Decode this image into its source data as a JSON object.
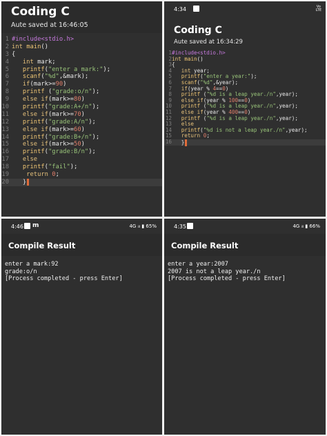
{
  "editor1": {
    "app_title": "Coding C",
    "autosave": "Aute saved at 16:46:05",
    "lines": [
      {
        "n": "1",
        "tokens": [
          [
            "pp",
            "#include<stdio.h>"
          ]
        ]
      },
      {
        "n": "2",
        "tokens": [
          [
            "kw",
            "int "
          ],
          [
            "fn",
            "main"
          ],
          [
            "",
            "()"
          ]
        ]
      },
      {
        "n": "3",
        "tokens": [
          [
            "",
            "{"
          ]
        ]
      },
      {
        "n": "4",
        "tokens": [
          [
            "",
            "   "
          ],
          [
            "kw",
            "int "
          ],
          [
            "",
            "mark;"
          ]
        ]
      },
      {
        "n": "5",
        "tokens": [
          [
            "",
            "   "
          ],
          [
            "fn",
            "printf"
          ],
          [
            "",
            "("
          ],
          [
            "st",
            "\"enter a mark:\""
          ],
          [
            "",
            ");"
          ]
        ]
      },
      {
        "n": "6",
        "tokens": [
          [
            "",
            "   "
          ],
          [
            "fn",
            "scanf"
          ],
          [
            "",
            "("
          ],
          [
            "st",
            "\"%d\""
          ],
          [
            "",
            ",&mark);"
          ]
        ]
      },
      {
        "n": "7",
        "tokens": [
          [
            "",
            "   "
          ],
          [
            "kw",
            "if"
          ],
          [
            "",
            "(mark>="
          ],
          [
            "nm",
            "90"
          ],
          [
            "",
            ")"
          ]
        ]
      },
      {
        "n": "8",
        "tokens": [
          [
            "",
            "   "
          ],
          [
            "fn",
            "printf"
          ],
          [
            "",
            " ("
          ],
          [
            "st",
            "\"grade:o/n\""
          ],
          [
            "",
            ");"
          ]
        ]
      },
      {
        "n": "9",
        "tokens": [
          [
            "",
            "   "
          ],
          [
            "kw",
            "else if"
          ],
          [
            "",
            "(mark>="
          ],
          [
            "nm",
            "80"
          ],
          [
            "",
            ")"
          ]
        ]
      },
      {
        "n": "10",
        "tokens": [
          [
            "",
            "   "
          ],
          [
            "fn",
            "printf"
          ],
          [
            "",
            "("
          ],
          [
            "st",
            "\"grade:A+/n\""
          ],
          [
            "",
            ");"
          ]
        ]
      },
      {
        "n": "11",
        "tokens": [
          [
            "",
            "   "
          ],
          [
            "kw",
            "else if"
          ],
          [
            "",
            "(mark>="
          ],
          [
            "nm",
            "70"
          ],
          [
            "",
            ")"
          ]
        ]
      },
      {
        "n": "12",
        "tokens": [
          [
            "",
            "   "
          ],
          [
            "fn",
            "printf"
          ],
          [
            "",
            "("
          ],
          [
            "st",
            "\"grade:A/n\""
          ],
          [
            "",
            ");"
          ]
        ]
      },
      {
        "n": "13",
        "tokens": [
          [
            "",
            "   "
          ],
          [
            "kw",
            "else if"
          ],
          [
            "",
            "(mark>="
          ],
          [
            "nm",
            "60"
          ],
          [
            "",
            ")"
          ]
        ]
      },
      {
        "n": "14",
        "tokens": [
          [
            "",
            "   "
          ],
          [
            "fn",
            "printf"
          ],
          [
            "",
            "("
          ],
          [
            "st",
            "\"grade:B+/n\""
          ],
          [
            "",
            ");"
          ]
        ]
      },
      {
        "n": "15",
        "tokens": [
          [
            "",
            "   "
          ],
          [
            "kw",
            "else if"
          ],
          [
            "",
            "(mark>="
          ],
          [
            "nm",
            "50"
          ],
          [
            "",
            ")"
          ]
        ]
      },
      {
        "n": "16",
        "tokens": [
          [
            "",
            "   "
          ],
          [
            "fn",
            "printf"
          ],
          [
            "",
            "("
          ],
          [
            "st",
            "\"grade:B/n\""
          ],
          [
            "",
            ");"
          ]
        ]
      },
      {
        "n": "17",
        "tokens": [
          [
            "",
            "   "
          ],
          [
            "kw",
            "else"
          ]
        ]
      },
      {
        "n": "18",
        "tokens": [
          [
            "",
            "   "
          ],
          [
            "fn",
            "printf"
          ],
          [
            "",
            "("
          ],
          [
            "st",
            "\"fail\""
          ],
          [
            "",
            ");"
          ]
        ]
      },
      {
        "n": "19",
        "tokens": [
          [
            "",
            "    "
          ],
          [
            "kw",
            "return "
          ],
          [
            "nm",
            "0"
          ],
          [
            "",
            ";"
          ]
        ]
      },
      {
        "n": "20",
        "tokens": [
          [
            "",
            "   }"
          ]
        ],
        "current": true
      }
    ]
  },
  "editor2": {
    "status_time": "4:34",
    "status_lte": "Vo\nLTE",
    "app_title": "Coding C",
    "autosave": "Aute saved at 16:34:29",
    "lines": [
      {
        "n": "1",
        "tokens": [
          [
            "pp",
            "#include<stdio.h>"
          ]
        ]
      },
      {
        "n": "2",
        "tokens": [
          [
            "kw",
            "int "
          ],
          [
            "fn",
            "main"
          ],
          [
            "",
            "()"
          ]
        ]
      },
      {
        "n": "3",
        "tokens": [
          [
            "",
            "{"
          ]
        ]
      },
      {
        "n": "4",
        "tokens": [
          [
            "",
            "   "
          ],
          [
            "kw",
            "int "
          ],
          [
            "",
            "year;"
          ]
        ]
      },
      {
        "n": "5",
        "tokens": [
          [
            "",
            "   "
          ],
          [
            "fn",
            "printf"
          ],
          [
            "",
            "("
          ],
          [
            "st",
            "\"enter a year:\""
          ],
          [
            "",
            ");"
          ]
        ]
      },
      {
        "n": "6",
        "tokens": [
          [
            "",
            "   "
          ],
          [
            "fn",
            "scanf"
          ],
          [
            "",
            "("
          ],
          [
            "st",
            "\"%d\""
          ],
          [
            "",
            ",&year);"
          ]
        ]
      },
      {
        "n": "7",
        "tokens": [
          [
            "",
            "   "
          ],
          [
            "kw",
            "if"
          ],
          [
            "",
            "(year % "
          ],
          [
            "nm",
            "4"
          ],
          [
            "",
            "=="
          ],
          [
            "nm",
            "0"
          ],
          [
            "",
            ")"
          ]
        ]
      },
      {
        "n": "8",
        "tokens": [
          [
            "",
            "   "
          ],
          [
            "fn",
            "printf"
          ],
          [
            "",
            " ("
          ],
          [
            "st",
            "\"%d is a leap year./n\""
          ],
          [
            "",
            ",year);"
          ]
        ]
      },
      {
        "n": "9",
        "tokens": [
          [
            "",
            "   "
          ],
          [
            "kw",
            "else if"
          ],
          [
            "",
            "(year % "
          ],
          [
            "nm",
            "100"
          ],
          [
            "",
            "=="
          ],
          [
            "nm",
            "0"
          ],
          [
            "",
            ")"
          ]
        ]
      },
      {
        "n": "10",
        "tokens": [
          [
            "",
            "   "
          ],
          [
            "fn",
            "printf"
          ],
          [
            "",
            " ("
          ],
          [
            "st",
            "\"%d is a leap year./n\""
          ],
          [
            "",
            ",year);"
          ]
        ]
      },
      {
        "n": "11",
        "tokens": [
          [
            "",
            "   "
          ],
          [
            "kw",
            "else if"
          ],
          [
            "",
            "(year % "
          ],
          [
            "nm",
            "400"
          ],
          [
            "",
            "=="
          ],
          [
            "nm",
            "0"
          ],
          [
            "",
            ")"
          ]
        ]
      },
      {
        "n": "12",
        "tokens": [
          [
            "",
            "   "
          ],
          [
            "fn",
            "printf"
          ],
          [
            "",
            " ("
          ],
          [
            "st",
            "\"%d is a leap year./n\""
          ],
          [
            "",
            ",year);"
          ]
        ]
      },
      {
        "n": "13",
        "tokens": [
          [
            "",
            "   "
          ],
          [
            "kw",
            "else"
          ]
        ]
      },
      {
        "n": "14",
        "tokens": [
          [
            "",
            "   "
          ],
          [
            "fn",
            "printf"
          ],
          [
            "",
            "("
          ],
          [
            "st",
            "\"%d is not a leap year./n\""
          ],
          [
            "",
            ",year);"
          ]
        ]
      },
      {
        "n": "15",
        "tokens": [
          [
            "",
            "   "
          ],
          [
            "kw",
            "return "
          ],
          [
            "nm",
            "0"
          ],
          [
            "",
            ";"
          ]
        ]
      },
      {
        "n": "16",
        "tokens": [
          [
            "",
            "   }"
          ]
        ],
        "current": true
      }
    ]
  },
  "result1": {
    "status_time": "4:46",
    "status_right": "4G ᵢₗₗ ▮ 65%",
    "title": "Compile Result",
    "output": [
      "enter a mark:92",
      "grade:o/n",
      "[Process completed - press Enter]"
    ]
  },
  "result2": {
    "status_time": "4:35",
    "status_right": "4G ᵢₗₗ ▮ 66%",
    "title": "Compile Result",
    "output": [
      "enter a year:2007",
      "2007 is not a leap year./n",
      "[Process completed - press Enter]"
    ]
  },
  "colors": {
    "panel_bg": "#2f2f2f",
    "keyword": "#e5c07b",
    "string": "#98c379",
    "number": "#e07e6a",
    "preprocessor": "#c679dd"
  }
}
